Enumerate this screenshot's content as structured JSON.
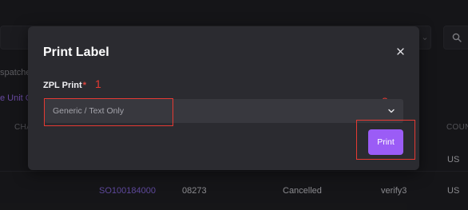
{
  "background": {
    "dispatched_text": "spatche",
    "unit_order_text": "e Unit O",
    "columns": {
      "cha": "CHA",
      "count": "COUN"
    },
    "row_top": {
      "country": "US"
    },
    "row": {
      "so_number": "SO100184000",
      "code": "08273",
      "status": "Cancelled",
      "user": "verify3",
      "country": "US"
    }
  },
  "modal": {
    "title": "Print Label",
    "close_label": "×",
    "field_label": "ZPL Print",
    "required_mark": "*",
    "selected_option": "Generic / Text Only",
    "print_label": "Print",
    "annotations": {
      "first": "1",
      "second": "2"
    }
  },
  "colors": {
    "accent": "#9b5cf6",
    "annotation": "#e53a33",
    "link": "#8b6ae6"
  },
  "icons": {
    "close": "close-icon",
    "select_chevron": "chevron-down-icon",
    "search": "search-icon"
  }
}
